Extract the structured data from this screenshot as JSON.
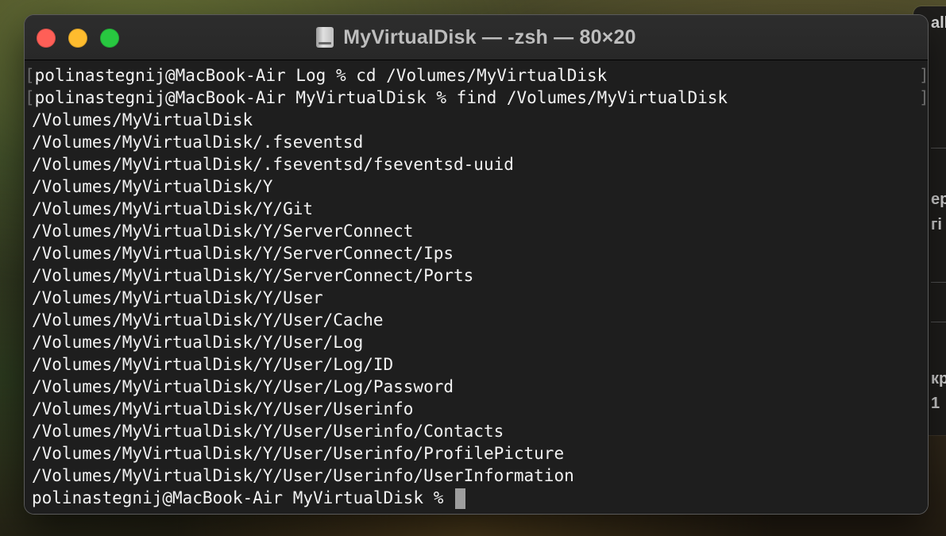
{
  "background_window": {
    "texts": [
      "all",
      "ер",
      "гі",
      "кр",
      "1"
    ]
  },
  "terminal": {
    "title": "MyVirtualDisk — -zsh — 80×20",
    "icon": "disk-icon",
    "commands": [
      {
        "prompt": "polinastegnij@MacBook-Air Log % ",
        "command": "cd /Volumes/MyVirtualDisk"
      },
      {
        "prompt": "polinastegnij@MacBook-Air MyVirtualDisk % ",
        "command": "find /Volumes/MyVirtualDisk"
      }
    ],
    "output": [
      "/Volumes/MyVirtualDisk",
      "/Volumes/MyVirtualDisk/.fseventsd",
      "/Volumes/MyVirtualDisk/.fseventsd/fseventsd-uuid",
      "/Volumes/MyVirtualDisk/Y",
      "/Volumes/MyVirtualDisk/Y/Git",
      "/Volumes/MyVirtualDisk/Y/ServerConnect",
      "/Volumes/MyVirtualDisk/Y/ServerConnect/Ips",
      "/Volumes/MyVirtualDisk/Y/ServerConnect/Ports",
      "/Volumes/MyVirtualDisk/Y/User",
      "/Volumes/MyVirtualDisk/Y/User/Cache",
      "/Volumes/MyVirtualDisk/Y/User/Log",
      "/Volumes/MyVirtualDisk/Y/User/Log/ID",
      "/Volumes/MyVirtualDisk/Y/User/Log/Password",
      "/Volumes/MyVirtualDisk/Y/User/Userinfo",
      "/Volumes/MyVirtualDisk/Y/User/Userinfo/Contacts",
      "/Volumes/MyVirtualDisk/Y/User/Userinfo/ProfilePicture",
      "/Volumes/MyVirtualDisk/Y/User/Userinfo/UserInformation"
    ],
    "current_prompt": "polinastegnij@MacBook-Air MyVirtualDisk % ",
    "bracket_left": "[",
    "bracket_right": "]"
  },
  "colors": {
    "close": "#ff5f57",
    "minimize": "#febc2e",
    "maximize": "#28c840",
    "terminal_bg": "#1e1e1e",
    "text": "#f2f2f2"
  }
}
